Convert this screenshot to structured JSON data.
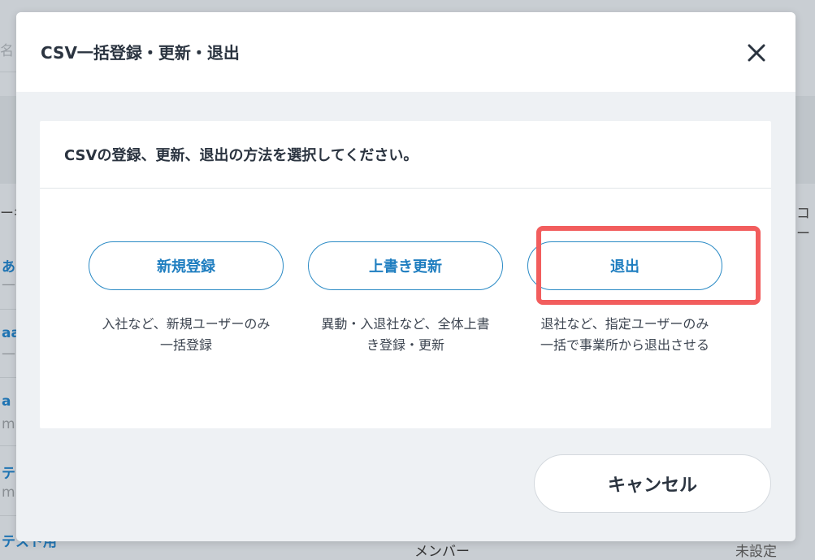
{
  "background": {
    "top_label": "名 /",
    "col_left_header": "ー名",
    "col_right_header": "コー",
    "rows": [
      {
        "name": "あ",
        "sub": "—"
      },
      {
        "name": "aa",
        "sub": "—"
      },
      {
        "name": "a",
        "sub": "m"
      },
      {
        "name": "テ",
        "sub": "m"
      },
      {
        "name": "テスト用",
        "sub": ""
      }
    ],
    "bottom_role": "メンバー",
    "bottom_status": "未設定"
  },
  "modal": {
    "title": "CSV一括登録・更新・退出",
    "prompt": "CSVの登録、更新、退出の方法を選択してください。",
    "options": [
      {
        "label": "新規登録",
        "desc_line1": "入社など、新規ユーザーのみ",
        "desc_line2": "一括登録"
      },
      {
        "label": "上書き更新",
        "desc_line1": "異動・入退社など、全体上書",
        "desc_line2": "き登録・更新"
      },
      {
        "label": "退出",
        "desc_line1": "退社など、指定ユーザーのみ",
        "desc_line2": "一括で事業所から退出させる"
      }
    ],
    "cancel_label": "キャンセル"
  },
  "colors": {
    "accent": "#1f7ec0",
    "highlight": "#f25d5d",
    "title_text": "#2b3440"
  },
  "icons": {
    "close": "close-icon"
  }
}
